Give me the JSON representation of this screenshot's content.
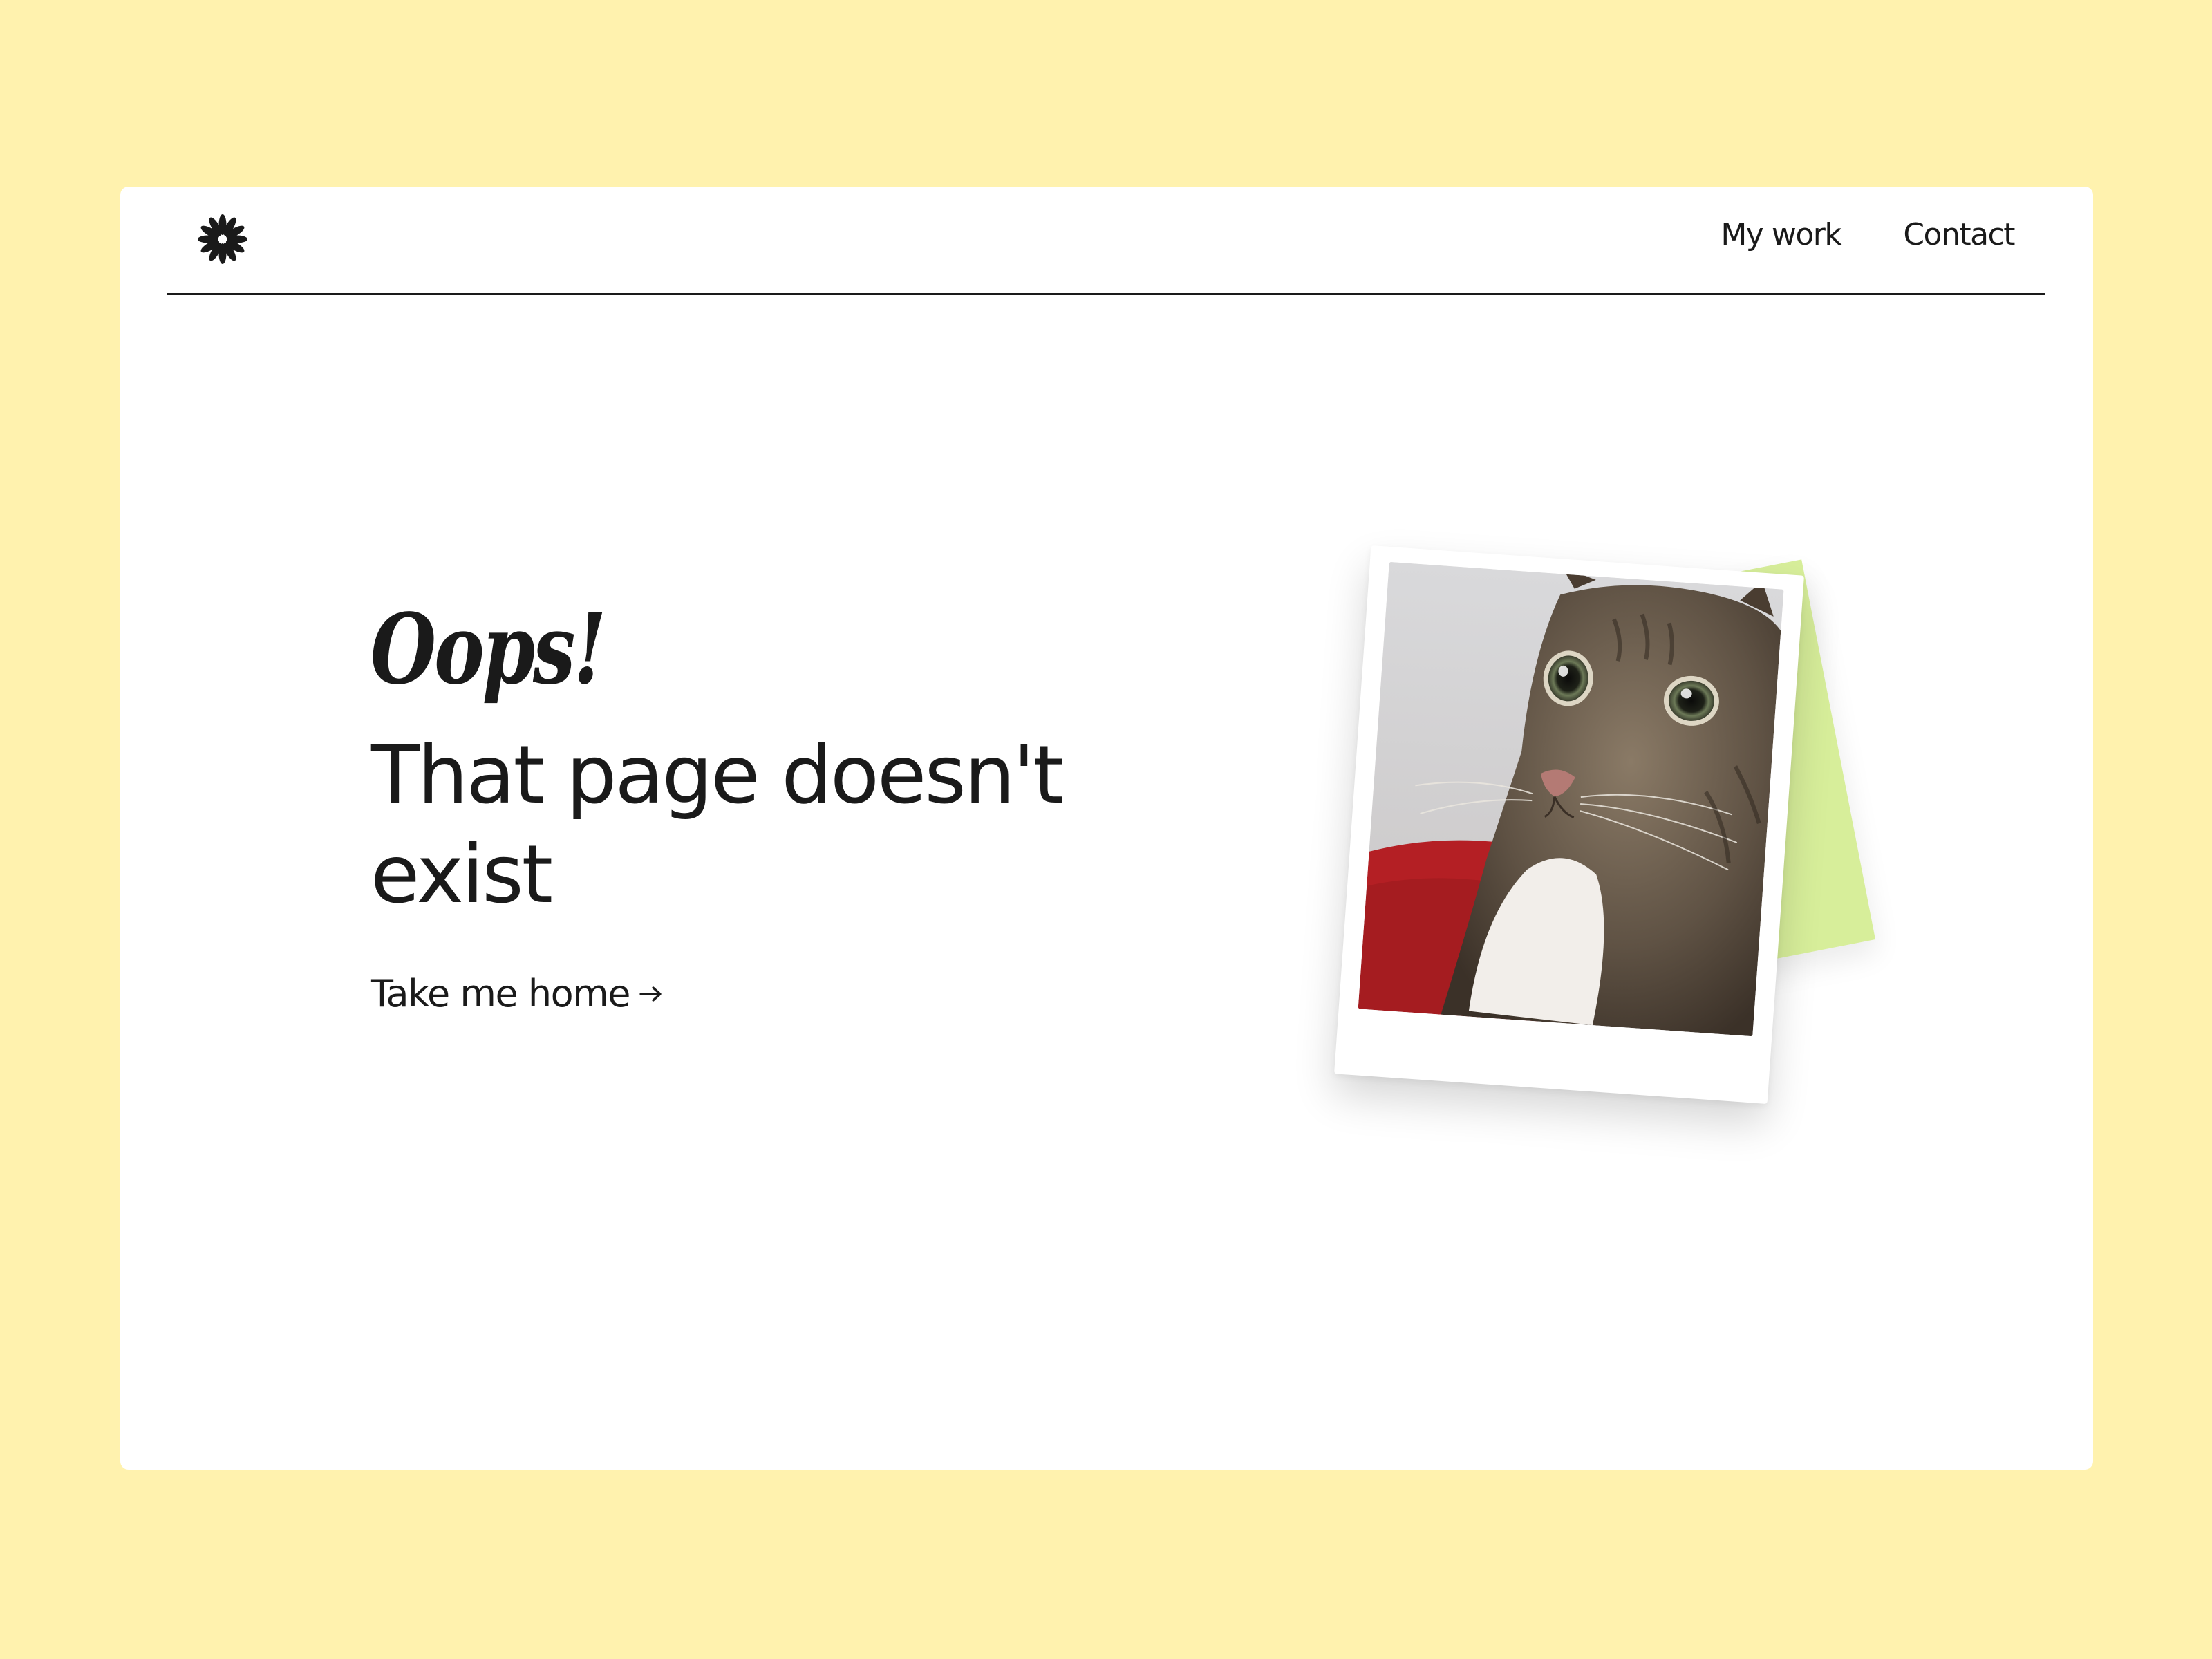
{
  "nav": {
    "logo_icon": "asterisk-flower-icon",
    "items": [
      {
        "label": "My work"
      },
      {
        "label": "Contact"
      }
    ]
  },
  "hero": {
    "exclamation": "Oops!",
    "message": "That page doesn't exist",
    "home_link": "Take me home",
    "arrow_icon": "arrow-right-icon"
  },
  "illustration": {
    "photo_icon": "cat-photo",
    "sticky_note_color": "#d7ee9a"
  },
  "colors": {
    "background": "#fff2ae",
    "card": "#ffffff",
    "text": "#1a1a1a"
  }
}
